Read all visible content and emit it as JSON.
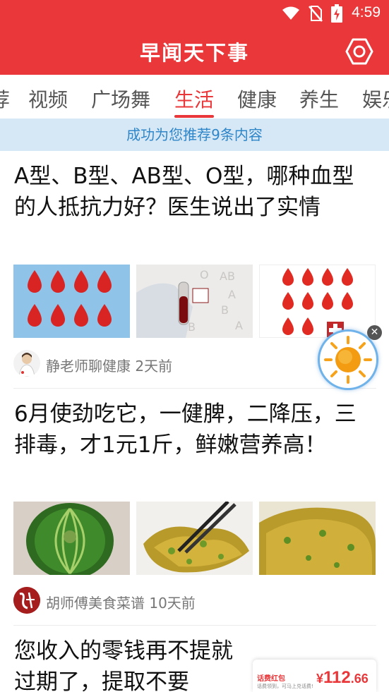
{
  "status_bar": {
    "time": "4:59"
  },
  "app_bar": {
    "title": "早闻天下事"
  },
  "tabs": [
    {
      "label": "荐"
    },
    {
      "label": "视频"
    },
    {
      "label": "广场舞"
    },
    {
      "label": "生活"
    },
    {
      "label": "健康"
    },
    {
      "label": "养生"
    },
    {
      "label": "娱乐"
    }
  ],
  "active_tab": "生活",
  "notice": "成功为您推荐9条内容",
  "articles": [
    {
      "title": "A型、B型、AB型、O型，哪种血型的人抵抗力好？医生说出了实情",
      "source": "静老师聊健康",
      "time": "2天前",
      "images": [
        "blood-drops-grid",
        "blood-sample-tube",
        "cartoon-blood-drops"
      ]
    },
    {
      "title": "6月使劲吃它，一健脾，二降压，三排毒，才1元1斤，鲜嫩营养高！",
      "source": "胡师傅美食菜谱",
      "time": "10天前",
      "images": [
        "green-pumpkin",
        "fried-dish-chopsticks",
        "fried-dish-plate"
      ]
    },
    {
      "title": "您收入的零钱再不提就过期了，提取不要"
    }
  ],
  "red_packet": {
    "title": "话费红包",
    "subtitle": "话费领到，可马上兑话费!",
    "currency": "¥",
    "amount_int": "112",
    "amount_dec": ".66"
  },
  "colors": {
    "brand_red": "#e9373a",
    "notice_bg": "#d6e8f5",
    "notice_text": "#2f86c9"
  },
  "icons": [
    "wifi-icon",
    "no-sim-icon",
    "battery-charging-icon",
    "settings-hexagon-icon",
    "sun-icon",
    "close-icon"
  ]
}
